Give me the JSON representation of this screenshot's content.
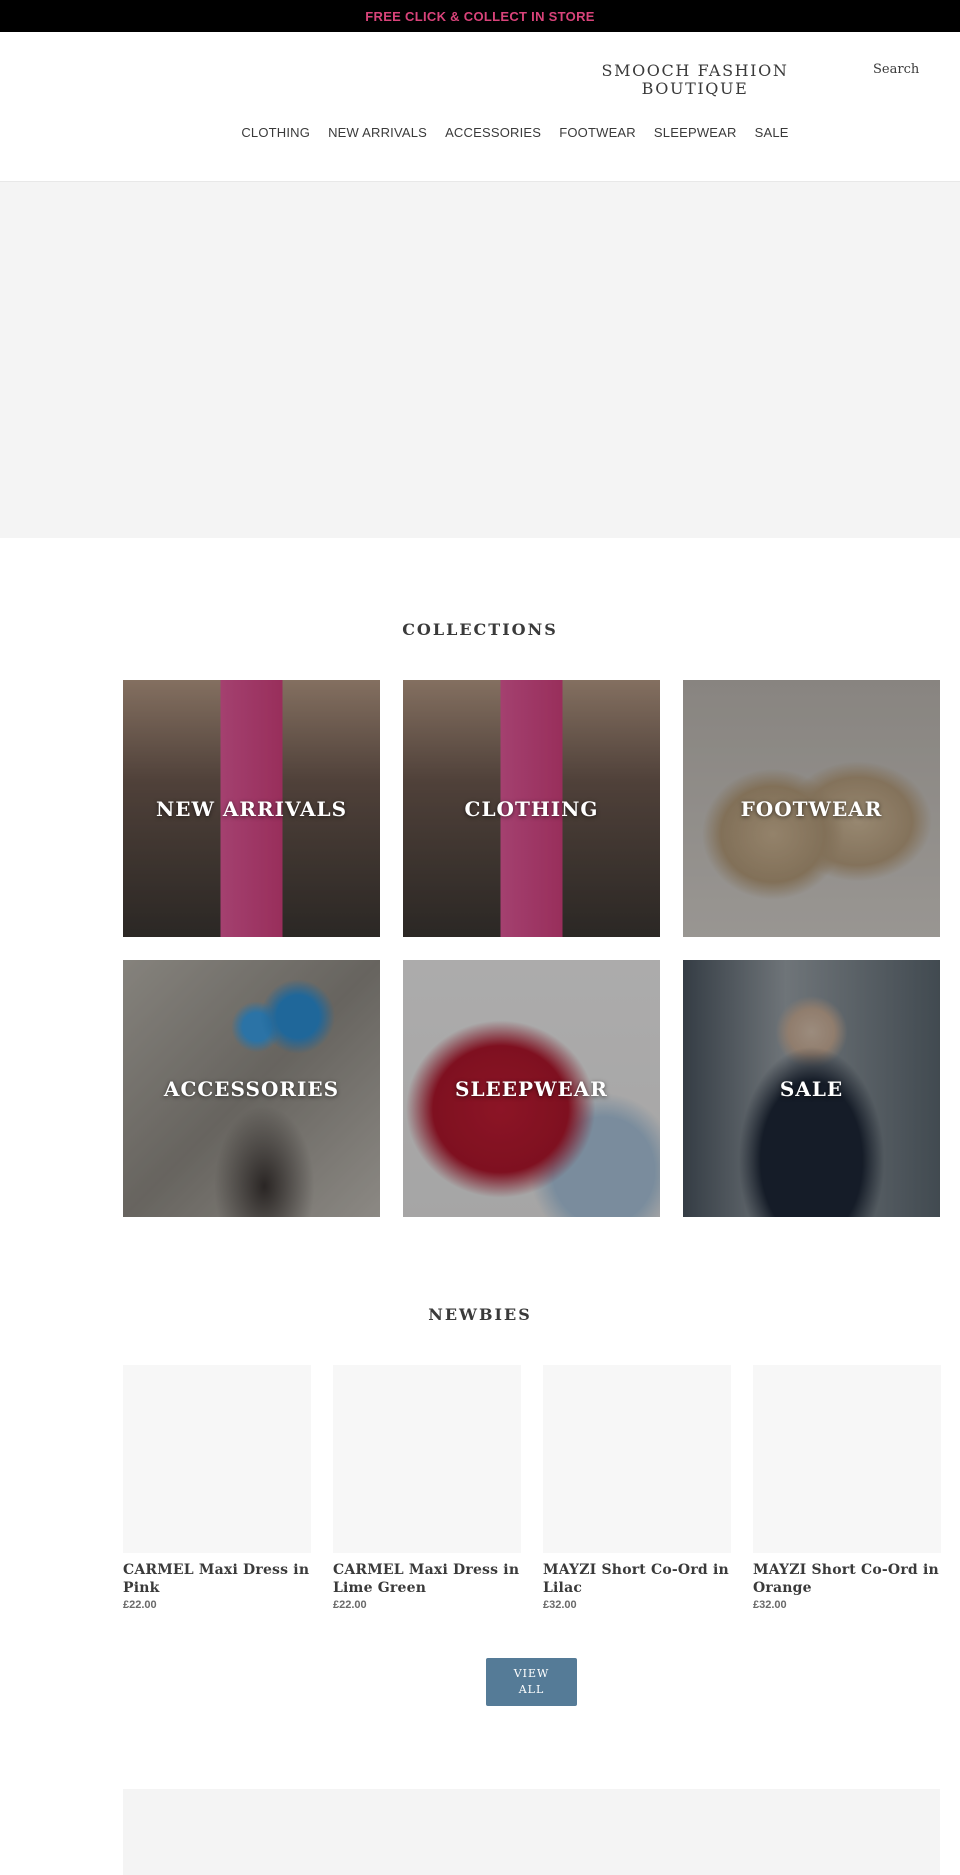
{
  "announcement": {
    "text": "FREE CLICK & COLLECT IN STORE",
    "color": "#d9437a"
  },
  "header": {
    "logo": "SMOOCH FASHION BOUTIQUE",
    "search_label": "Search",
    "nav": [
      "CLOTHING",
      "NEW ARRIVALS",
      "ACCESSORIES",
      "FOOTWEAR",
      "SLEEPWEAR",
      "SALE"
    ]
  },
  "collections": {
    "title": "COLLECTIONS",
    "items": [
      "NEW ARRIVALS",
      "CLOTHING",
      "FOOTWEAR",
      "ACCESSORIES",
      "SLEEPWEAR",
      "SALE"
    ]
  },
  "newbies": {
    "title": "NEWBIES",
    "products": [
      {
        "name": "CARMEL Maxi Dress in Pink",
        "price": "£22.00"
      },
      {
        "name": "CARMEL Maxi Dress in Lime Green",
        "price": "£22.00"
      },
      {
        "name": "MAYZI Short Co-Ord in Lilac",
        "price": "£32.00"
      },
      {
        "name": "MAYZI Short Co-Ord in Orange",
        "price": "£32.00"
      }
    ],
    "view_all_label": "VIEW ALL"
  },
  "colors": {
    "button": "#557b97",
    "placeholder": "#f7f7f7",
    "hero": "#f4f4f4"
  }
}
